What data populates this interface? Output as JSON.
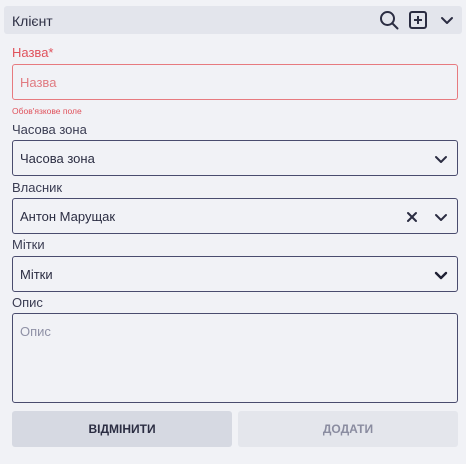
{
  "header": {
    "title": "Клієнт",
    "icons": [
      "search-icon",
      "add-square-icon",
      "chevron-down-icon"
    ]
  },
  "form": {
    "name": {
      "label": "Назва*",
      "placeholder": "Назва",
      "hint": "Обов'язкове поле"
    },
    "timezone": {
      "label": "Часова зона",
      "value": "Часова зона"
    },
    "owner": {
      "label": "Власник",
      "value": "Антон Марущак"
    },
    "tags": {
      "label": "Мітки",
      "value": "Мітки"
    },
    "description": {
      "label": "Опис",
      "placeholder": "Опис"
    }
  },
  "actions": {
    "cancel_label": "ВІДМІНИТИ",
    "add_label": "ДОДАТИ"
  },
  "colors": {
    "error": "#e0525c",
    "border": "#4a4c6e",
    "background": "#f1f2f6"
  }
}
